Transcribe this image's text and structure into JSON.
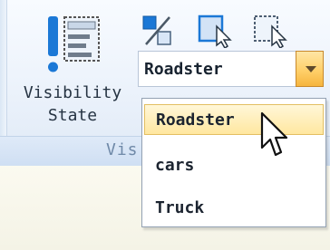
{
  "ribbon": {
    "visibility_state_label": "Visibility\nState",
    "group_label_partial": "Vis"
  },
  "combo": {
    "selected": "Roadster"
  },
  "dropdown": {
    "options": [
      "Roadster",
      "cars",
      "Truck"
    ]
  },
  "icons": {
    "visibility_state": "visibility-state-icon",
    "tool_1": "percent-table-icon",
    "tool_2": "select-cursor-icon",
    "tool_3": "pointer-cursor-icon",
    "dropdown_arrow": "chevron-down-icon",
    "cursor": "mouse-cursor-icon"
  },
  "colors": {
    "ribbon_top": "#f8fbff",
    "ribbon_bottom": "#dfe9f6",
    "accent_blue": "#1b78d6",
    "dropdown_highlight": "#ffe7a0",
    "arrow_highlight": "#ffd06a"
  }
}
